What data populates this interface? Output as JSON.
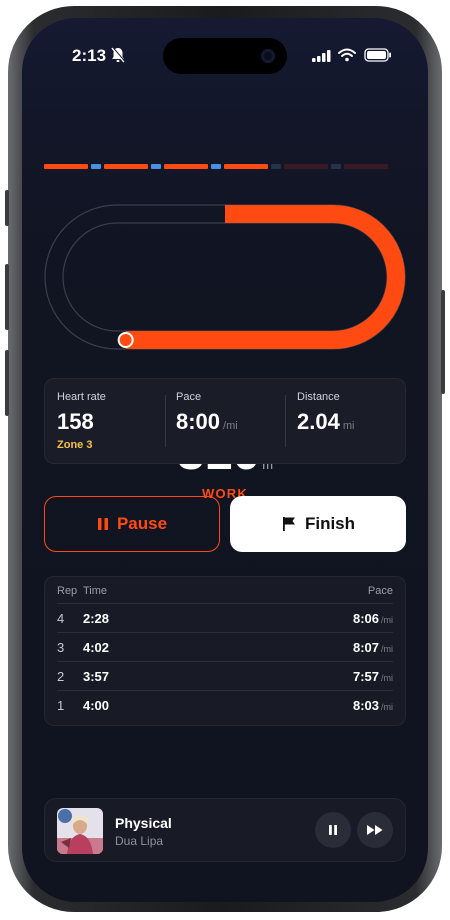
{
  "status_bar": {
    "time": "2:13"
  },
  "progress_segments": [
    {
      "kind": "work",
      "state": "done",
      "color": "#ff4a12"
    },
    {
      "kind": "rest",
      "state": "done",
      "color": "#4a90e2"
    },
    {
      "kind": "work",
      "state": "done",
      "color": "#ff4a12"
    },
    {
      "kind": "rest",
      "state": "done",
      "color": "#4a90e2"
    },
    {
      "kind": "work",
      "state": "done",
      "color": "#ff4a12"
    },
    {
      "kind": "rest",
      "state": "done",
      "color": "#4a90e2"
    },
    {
      "kind": "work",
      "state": "active",
      "color": "#ff4a12"
    },
    {
      "kind": "rest",
      "state": "pending",
      "color": "#24324a"
    },
    {
      "kind": "work",
      "state": "pending",
      "color": "#3a1a22"
    },
    {
      "kind": "rest",
      "state": "pending",
      "color": "#24324a"
    },
    {
      "kind": "work",
      "state": "pending",
      "color": "#3a1a22"
    }
  ],
  "track": {
    "distance": "310",
    "unit": "m",
    "phase": "WORK",
    "progress_fraction": 0.62
  },
  "stats": {
    "heart_rate": {
      "label": "Heart rate",
      "value": "158",
      "zone": "Zone 3"
    },
    "pace": {
      "label": "Pace",
      "value": "8:00",
      "unit": "/mi"
    },
    "distance": {
      "label": "Distance",
      "value": "2.04",
      "unit": "mi"
    }
  },
  "buttons": {
    "pause": "Pause",
    "finish": "Finish"
  },
  "laps": {
    "headers": {
      "rep": "Rep",
      "time": "Time",
      "pace": "Pace"
    },
    "rows": [
      {
        "rep": "4",
        "time": "2:28",
        "pace": "8:06",
        "unit": "/mi"
      },
      {
        "rep": "3",
        "time": "4:02",
        "pace": "8:07",
        "unit": "/mi"
      },
      {
        "rep": "2",
        "time": "3:57",
        "pace": "7:57",
        "unit": "/mi"
      },
      {
        "rep": "1",
        "time": "4:00",
        "pace": "8:03",
        "unit": "/mi"
      }
    ]
  },
  "now_playing": {
    "title": "Physical",
    "artist": "Dua Lipa"
  },
  "colors": {
    "accent": "#ff4a12",
    "rest": "#4a90e2",
    "zone": "#f6c24c"
  }
}
